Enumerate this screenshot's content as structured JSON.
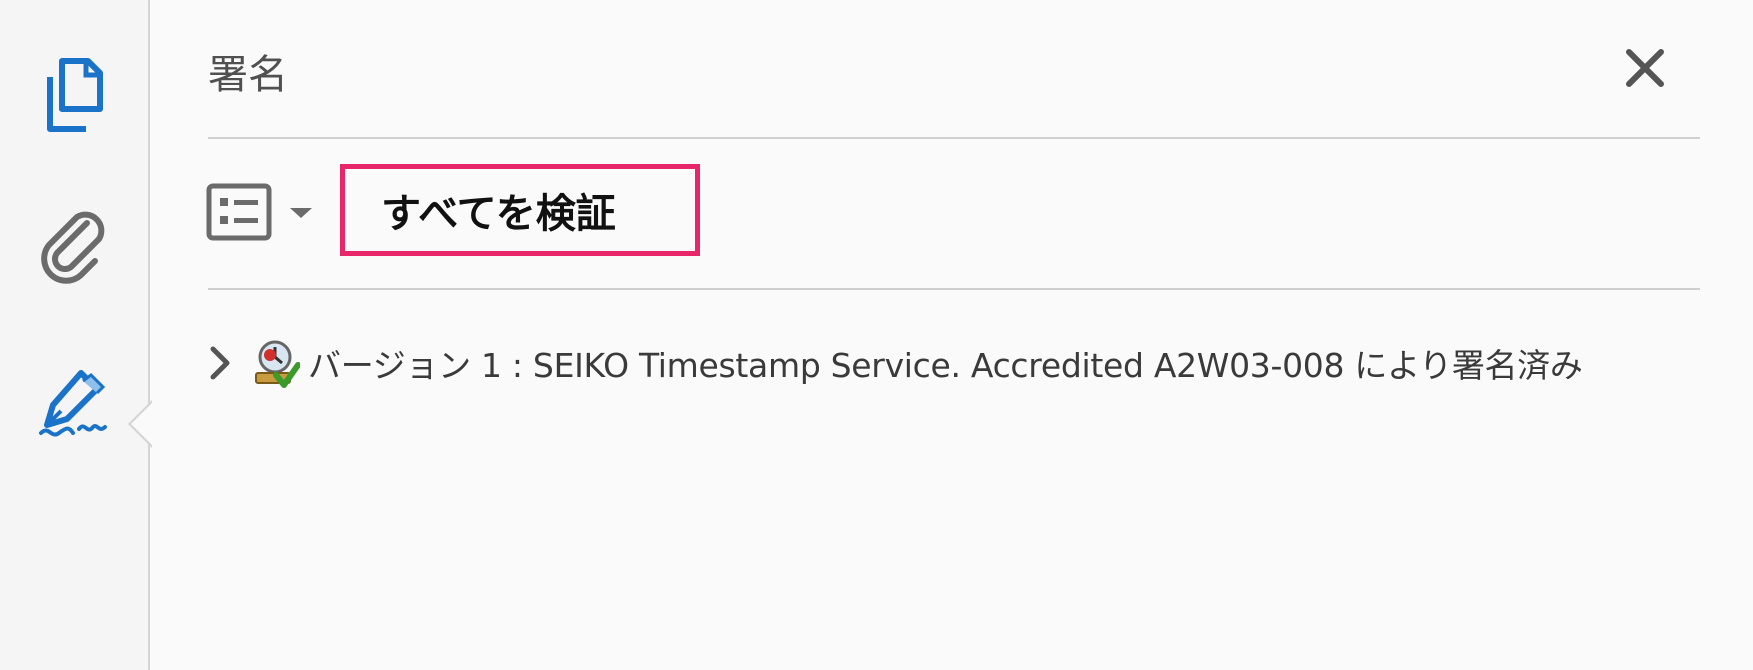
{
  "panel": {
    "title": "署名",
    "close_icon": "close-icon"
  },
  "rail": {
    "items": [
      {
        "name": "pages",
        "icon": "copy-pages-icon"
      },
      {
        "name": "attachments",
        "icon": "paperclip-icon"
      },
      {
        "name": "signatures",
        "icon": "signature-pen-icon",
        "active": true
      }
    ]
  },
  "toolbar": {
    "options_icon": "list-options-icon",
    "verify_all_label": "すべてを検証",
    "highlight_color": "#e8266a"
  },
  "signatures": [
    {
      "label": "バージョン 1 : SEIKO Timestamp Service. Accredited A2W03-008 により署名済み",
      "icon": "timestamp-signature-valid-icon",
      "expanded": false
    }
  ],
  "colors": {
    "accent": "#1a73c8",
    "icon_gray": "#6b6b6b"
  }
}
